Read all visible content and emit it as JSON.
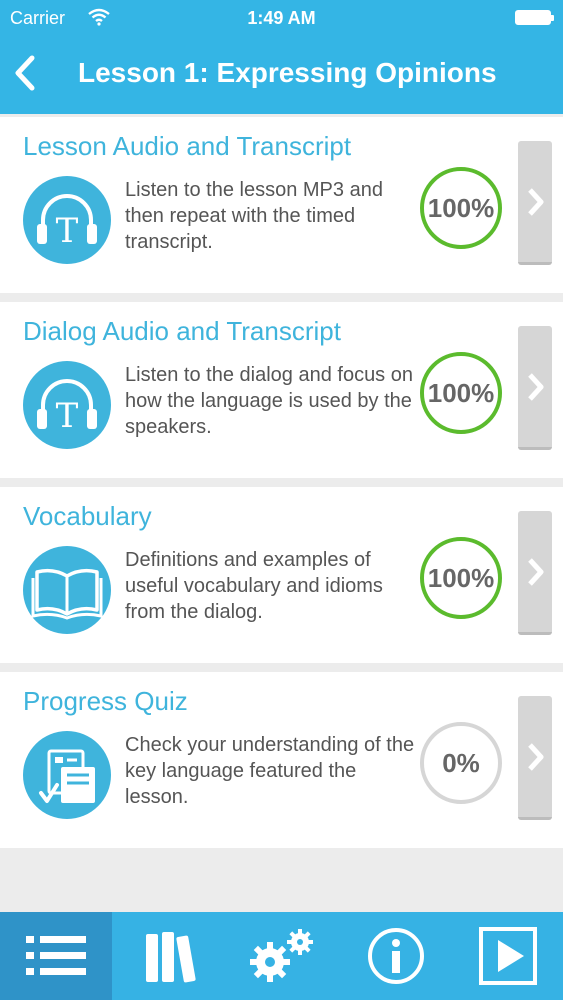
{
  "status_bar": {
    "carrier": "Carrier",
    "time": "1:49 AM"
  },
  "header": {
    "title": "Lesson 1: Expressing Opinions",
    "back_icon": "chevron-left-icon"
  },
  "sections": [
    {
      "title": "Lesson Audio and Transcript",
      "description": "Listen to the lesson MP3 and then repeat with the timed transcript.",
      "progress": "100%",
      "icon": "headphones-transcript-icon"
    },
    {
      "title": "Dialog Audio and Transcript",
      "description": "Listen to the dialog and focus on how the language is used by the speakers.",
      "progress": "100%",
      "icon": "headphones-transcript-icon"
    },
    {
      "title": "Vocabulary",
      "description": "Definitions and examples of useful vocabulary and idioms from the dialog.",
      "progress": "100%",
      "icon": "open-book-icon"
    },
    {
      "title": "Progress Quiz",
      "description": "Check your understanding of the key language featured the lesson.",
      "progress": "0%",
      "icon": "quiz-checklist-icon"
    }
  ],
  "tab_bar": {
    "active_tab": "list",
    "tabs": [
      "list-icon",
      "books-icon",
      "settings-gears-icon",
      "info-icon",
      "play-icon"
    ]
  },
  "colors": {
    "header": "#34b5e5",
    "accent": "#3fb4dc",
    "complete": "#5bbb2d",
    "incomplete": "#d6d6d6"
  }
}
